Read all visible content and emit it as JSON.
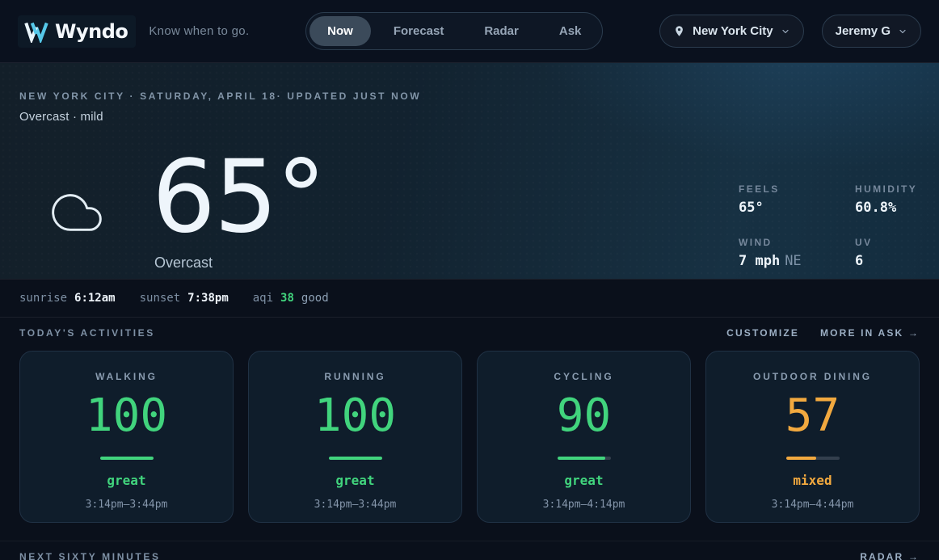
{
  "brand": {
    "name": "Wyndo",
    "tagline": "Know when to go."
  },
  "nav": {
    "tabs": [
      {
        "label": "Now",
        "active": true
      },
      {
        "label": "Forecast",
        "active": false
      },
      {
        "label": "Radar",
        "active": false
      },
      {
        "label": "Ask",
        "active": false
      }
    ],
    "location": {
      "label": "New York City"
    },
    "user": {
      "label": "Jeremy G"
    }
  },
  "hero": {
    "meta": "NEW YORK CITY · SATURDAY, APRIL 18· UPDATED JUST NOW",
    "summary": "Overcast · mild",
    "temperature": "65°",
    "condition": "Overcast",
    "stats": [
      {
        "label": "FEELS",
        "value": "65°",
        "suffix": ""
      },
      {
        "label": "HUMIDITY",
        "value": "60.8%",
        "suffix": ""
      },
      {
        "label": "WIND",
        "value": "7 mph",
        "suffix": "NE"
      },
      {
        "label": "UV",
        "value": "6",
        "suffix": ""
      }
    ],
    "sun_row": {
      "sunrise_label": "sunrise",
      "sunrise_value": "6:12am",
      "sunset_label": "sunset",
      "sunset_value": "7:38pm",
      "aqi_label": "aqi",
      "aqi_value": "38",
      "aqi_status": "good"
    }
  },
  "activities": {
    "title": "TODAY'S ACTIVITIES",
    "customize_label": "CUSTOMIZE",
    "more_label": "MORE IN ASK →",
    "cards": [
      {
        "name": "WALKING",
        "score": 100,
        "status": "great",
        "window": "3:14pm–3:44pm",
        "color": "green"
      },
      {
        "name": "RUNNING",
        "score": 100,
        "status": "great",
        "window": "3:14pm–3:44pm",
        "color": "green"
      },
      {
        "name": "CYCLING",
        "score": 90,
        "status": "great",
        "window": "3:14pm–4:14pm",
        "color": "green"
      },
      {
        "name": "OUTDOOR DINING",
        "score": 57,
        "status": "mixed",
        "window": "3:14pm–4:44pm",
        "color": "orange"
      }
    ]
  },
  "footer": {
    "title": "NEXT SIXTY MINUTES",
    "link": "RADAR →"
  },
  "colors": {
    "accent_green": "#41d47d",
    "accent_orange": "#f2a93f",
    "brand_cyan": "#56c8e9"
  }
}
